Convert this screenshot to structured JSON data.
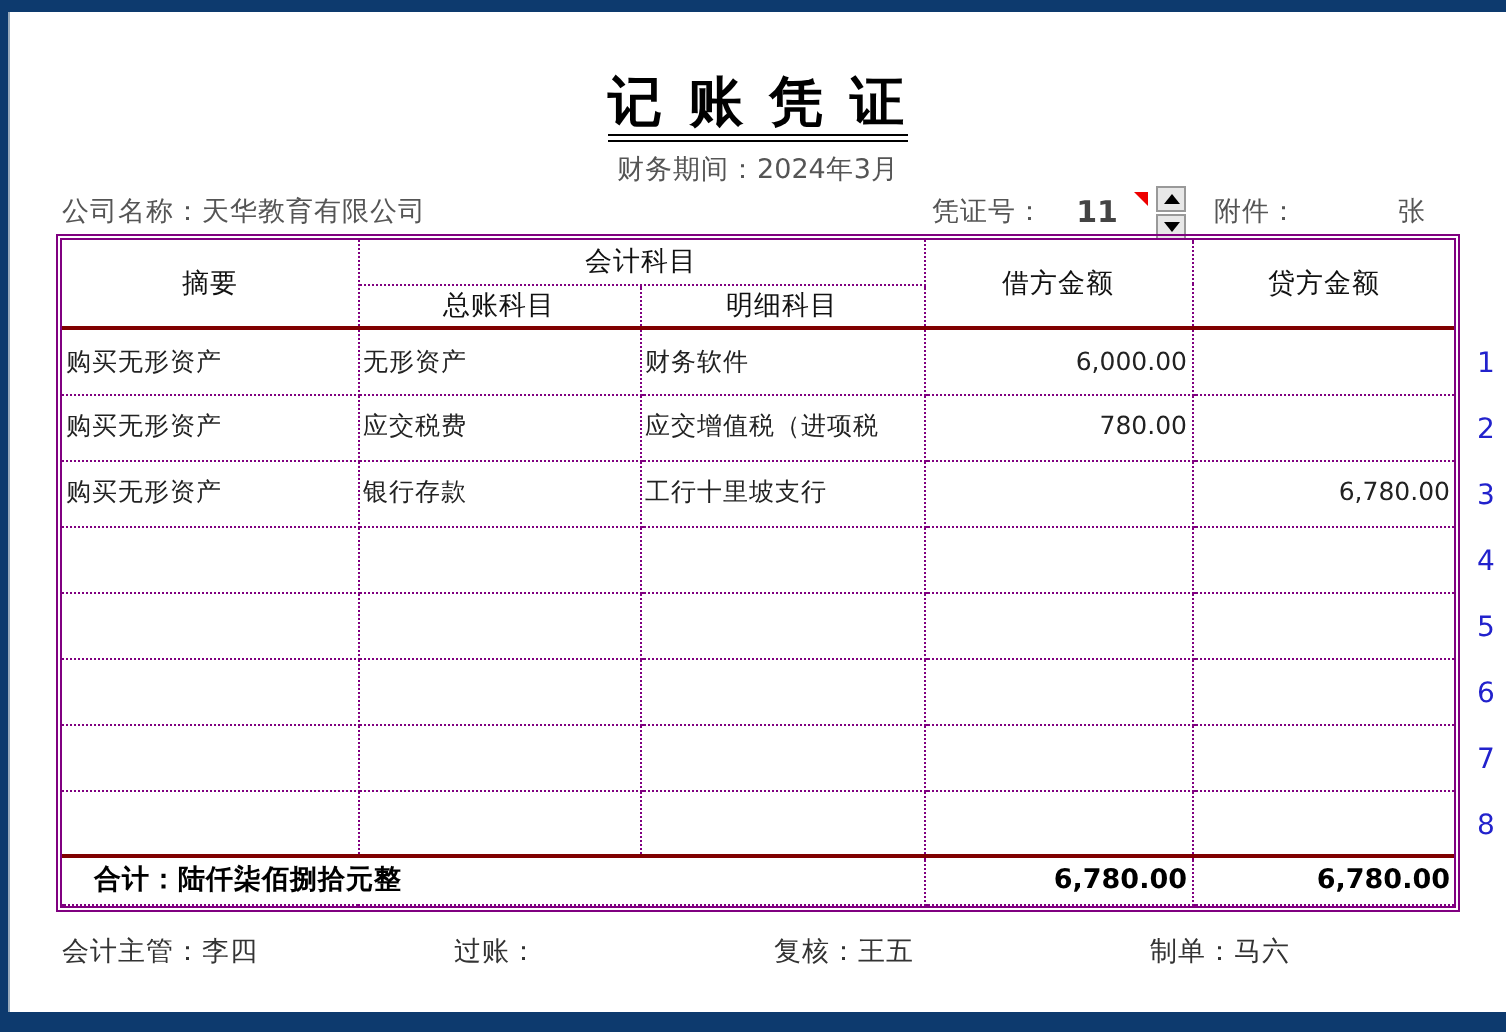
{
  "title": "记 账 凭 证",
  "period": "财务期间：2024年3月",
  "company": "公司名称：天华教育有限公司",
  "voucher_no_label": "凭证号：",
  "voucher_no": "11",
  "attachments_label": "附件：",
  "attachments_unit": "张",
  "table": {
    "columns": {
      "summary": "摘要",
      "account_group": "会计科目",
      "general_account": "总账科目",
      "detail_account": "明细科目",
      "debit": "借方金额",
      "credit": "贷方金额"
    },
    "rows": [
      {
        "summary": "购买无形资产",
        "general_account": "无形资产",
        "detail_account": "财务软件",
        "debit": "6,000.00",
        "line_no": "1"
      },
      {
        "summary": "购买无形资产",
        "general_account": "应交税费",
        "detail_account": "应交增值税（进项税",
        "debit": "780.00",
        "line_no": "2"
      },
      {
        "summary": "购买无形资产",
        "general_account": "银行存款",
        "detail_account": "工行十里坡支行",
        "credit": "6,780.00",
        "line_no": "3"
      },
      {
        "line_no": "4"
      },
      {
        "line_no": "5"
      },
      {
        "line_no": "6"
      },
      {
        "line_no": "7"
      },
      {
        "line_no": "8"
      }
    ],
    "total": {
      "label": "合计：陆仟柒佰捌拾元整",
      "debit": "6,780.00",
      "credit": "6,780.00"
    }
  },
  "signatures": [
    "会计主管：李四",
    "过账：",
    "复核：王五",
    "制单：马六"
  ]
}
